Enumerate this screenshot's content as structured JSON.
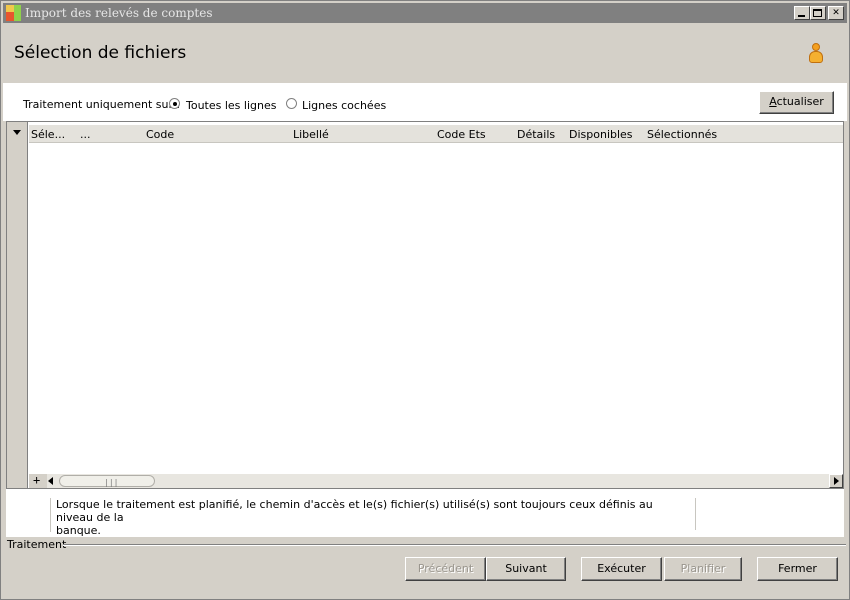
{
  "window": {
    "title": "Import des relevés de comptes"
  },
  "header": {
    "title": "Sélection de fichiers"
  },
  "options": {
    "label": "Traitement uniquement sur :",
    "radio_all": "Toutes les lignes",
    "radio_checked": "Lignes cochées",
    "selected": "Toutes les lignes",
    "refresh_button": "Actualiser"
  },
  "grid": {
    "columns": [
      "Séle...",
      "...",
      "Code",
      "Libellé",
      "Code Ets",
      "Détails",
      "Disponibles",
      "Sélectionnés"
    ],
    "rows": []
  },
  "info": {
    "line1": "Lorsque le traitement est planifié, le chemin d'accès et le(s) fichier(s) utilisé(s) sont toujours ceux définis au niveau de la",
    "line2": "banque."
  },
  "footer": {
    "group_label": "Traitement",
    "previous": "Précédent",
    "next": "Suivant",
    "execute": "Exécuter",
    "schedule": "Planifier",
    "close": "Fermer"
  },
  "colors": {
    "titlebar_inactive": "#808080",
    "face": "#d4d0c8",
    "panel": "#ffffff"
  }
}
